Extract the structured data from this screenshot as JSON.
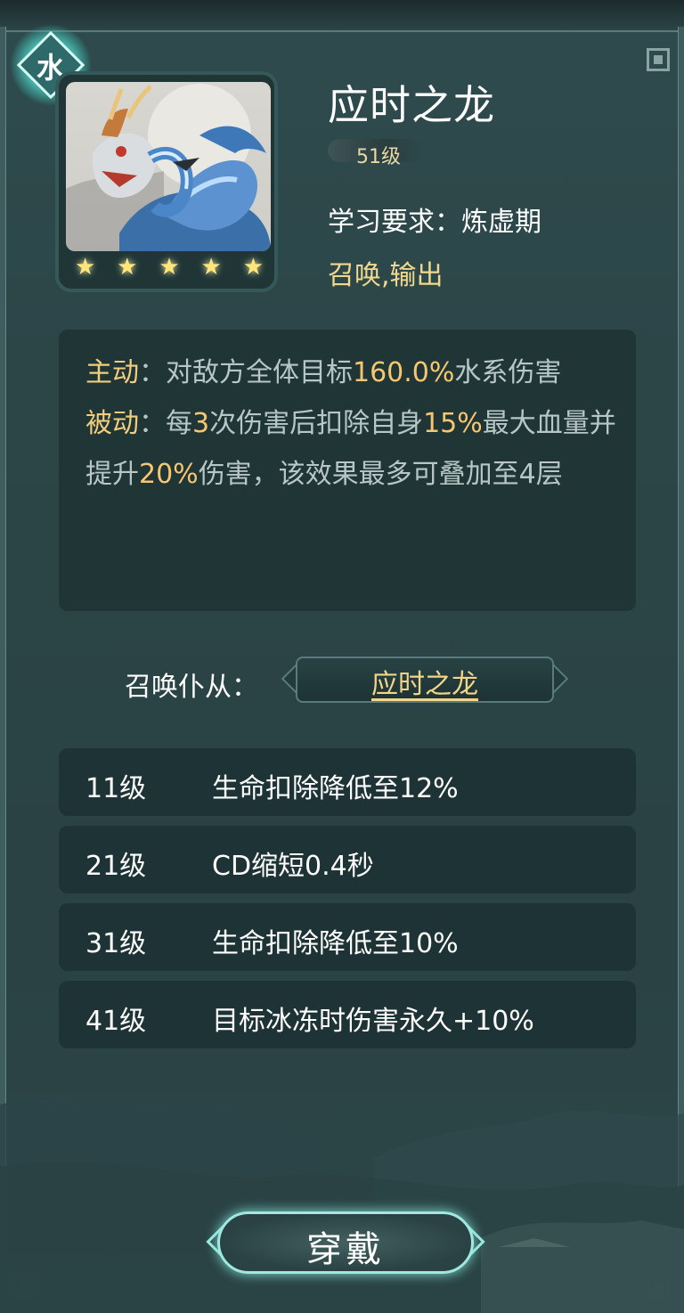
{
  "element": {
    "glyph": "水",
    "icon": "water-element-badge-icon",
    "color": "#4fd3c6"
  },
  "skill": {
    "name": "应时之龙",
    "level": "51级",
    "requirement_label": "学习要求：",
    "requirement_value": "炼虚期",
    "roles": "召唤,输出",
    "stars": 5,
    "portrait_icon": "blue-dragon-portrait-icon"
  },
  "description": {
    "active_label": "主动",
    "active_sep": "：",
    "active_text_1": "对敌方全体目标",
    "active_value": "160.0%",
    "active_text_2": "水系伤害",
    "passive_label": "被动",
    "passive_sep": "：",
    "passive_text_1": "每",
    "passive_value_1": "3",
    "passive_text_2": "次伤害后扣除自身",
    "passive_value_2": "15%",
    "passive_text_3": "最大血量并提升",
    "passive_value_3": "20%",
    "passive_text_4": "伤害，该效果最多可叠加至4层"
  },
  "summon": {
    "label": "召唤仆从：",
    "link": "应时之龙"
  },
  "upgrades": [
    {
      "level": "11级",
      "effect": "生命扣除降低至12%"
    },
    {
      "level": "21级",
      "effect": "CD缩短0.4秒"
    },
    {
      "level": "31级",
      "effect": "生命扣除降低至10%"
    },
    {
      "level": "41级",
      "effect": "目标冰冻时伤害永久+10%"
    }
  ],
  "actions": {
    "equip_label": "穿戴"
  },
  "colors": {
    "gold": "#f2cd7d",
    "accent_glow": "#9fe9e1",
    "panel": "#1d3234"
  }
}
